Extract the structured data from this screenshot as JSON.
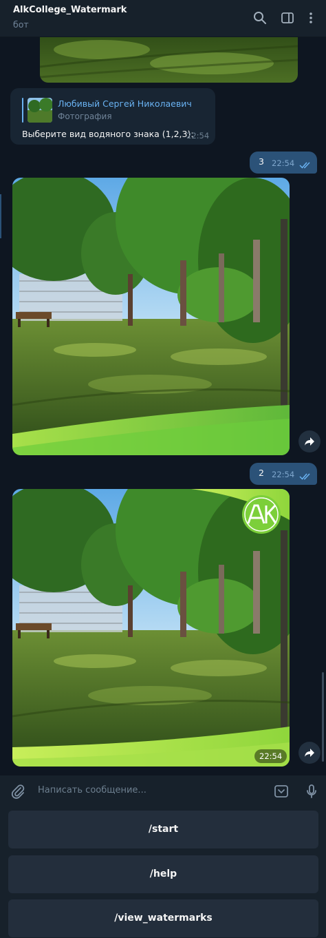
{
  "header": {
    "title": "AlkCollege_Watermark",
    "subtitle": "бот",
    "icons": [
      "search-icon",
      "sidebar-toggle-icon",
      "more-vertical-icon"
    ]
  },
  "messages": {
    "reply_card": {
      "reply_to_name": "Любивый Сергей Николаевич",
      "reply_to_type": "Фотография",
      "text": "Выберите вид водяного знака (1,2,3):",
      "time": "22:54"
    },
    "out_1": {
      "text": "3",
      "time": "22:54"
    },
    "out_2": {
      "text": "2",
      "time": "22:54"
    },
    "photo_2": {
      "time": "22:54",
      "watermark_logo_text": "AK"
    }
  },
  "composer": {
    "placeholder": "Написать сообщение...",
    "icons": [
      "attach-icon",
      "bot-keyboard-icon",
      "microphone-icon"
    ]
  },
  "keyboard": {
    "buttons": [
      "/start",
      "/help",
      "/view_watermarks"
    ]
  },
  "colors": {
    "background": "#0e1621",
    "header": "#17212b",
    "incoming_bubble": "#182533",
    "outgoing_bubble": "#2b5278",
    "accent": "#6ab3f3",
    "watermark_green": "#8fd63c"
  }
}
